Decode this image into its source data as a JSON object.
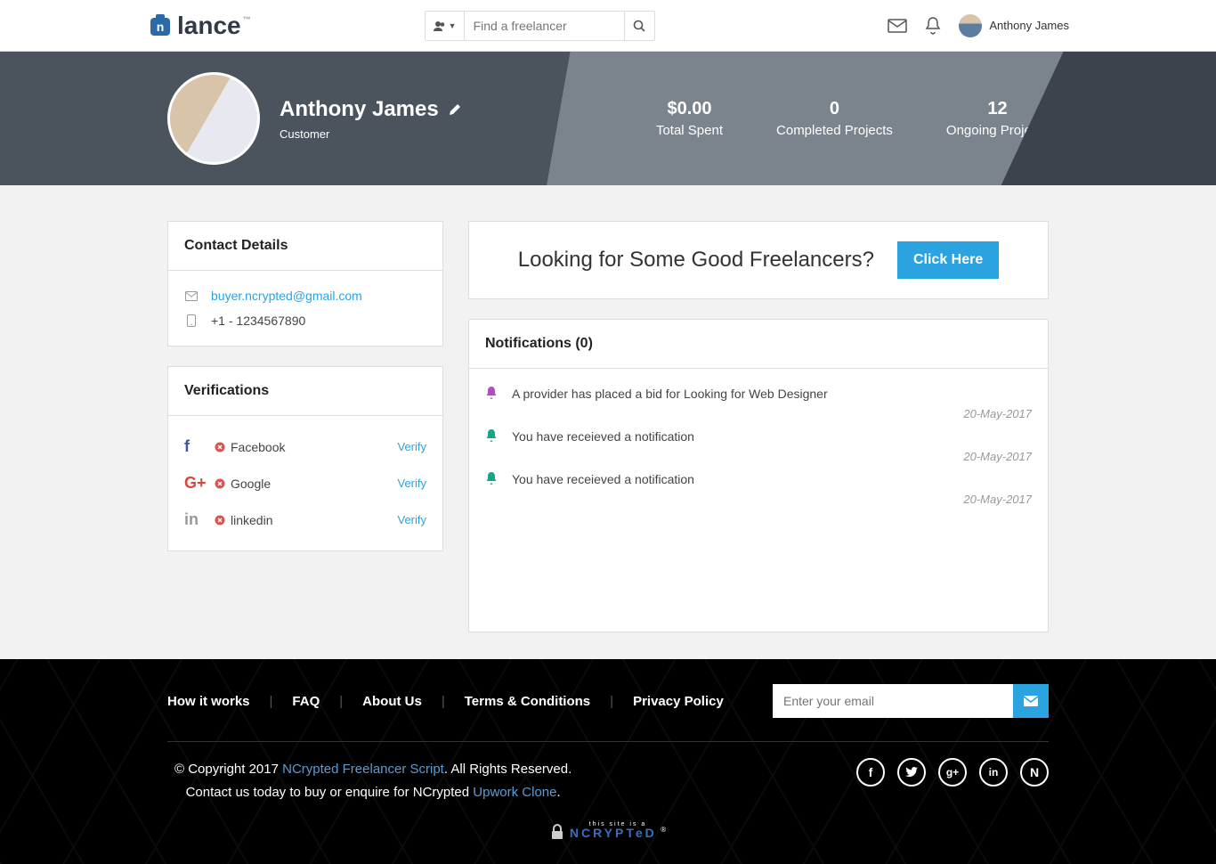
{
  "brand": "lance",
  "search": {
    "placeholder": "Find a freelancer"
  },
  "header_user": "Anthony James",
  "profile": {
    "name": "Anthony James",
    "role": "Customer",
    "stats": [
      {
        "value": "$0.00",
        "label": "Total Spent"
      },
      {
        "value": "0",
        "label": "Completed Projects"
      },
      {
        "value": "12",
        "label": "Ongoing Projects"
      }
    ]
  },
  "contact": {
    "title": "Contact Details",
    "email": "buyer.ncrypted@gmail.com",
    "phone": "+1 - 1234567890"
  },
  "verifications": {
    "title": "Verifications",
    "verify_label": "Verify",
    "items": [
      {
        "name": "Facebook",
        "icon": "f",
        "color": "#3b5998"
      },
      {
        "name": "Google",
        "icon": "G+",
        "color": "#db4437"
      },
      {
        "name": "linkedin",
        "icon": "in",
        "color": "#999999"
      }
    ]
  },
  "cta": {
    "text": "Looking for Some Good Freelancers?",
    "button": "Click Here"
  },
  "notifications": {
    "title": "Notifications (0)",
    "items": [
      {
        "text": "A provider has placed a bid for Looking for Web Designer",
        "date": "20-May-2017",
        "color": "#b24fc0"
      },
      {
        "text": "You have receieved a notification",
        "date": "20-May-2017",
        "color": "#17a589"
      },
      {
        "text": "You have receieved a notification",
        "date": "20-May-2017",
        "color": "#17a589"
      }
    ]
  },
  "footer": {
    "links": [
      "How it works",
      "FAQ",
      "About Us",
      "Terms & Conditions",
      "Privacy Policy"
    ],
    "email_placeholder": "Enter your email",
    "copyright_prefix": "© Copyright 2017 ",
    "script_link": "NCrypted Freelancer Script",
    "copyright_suffix": ". All Rights Reserved.",
    "contact_line_prefix": "Contact us today to buy or enquire for NCrypted ",
    "upwork_link": "Upwork Clone",
    "contact_line_suffix": ".",
    "badge_top": "this site is a",
    "badge_text": "NCRYPTeD"
  }
}
